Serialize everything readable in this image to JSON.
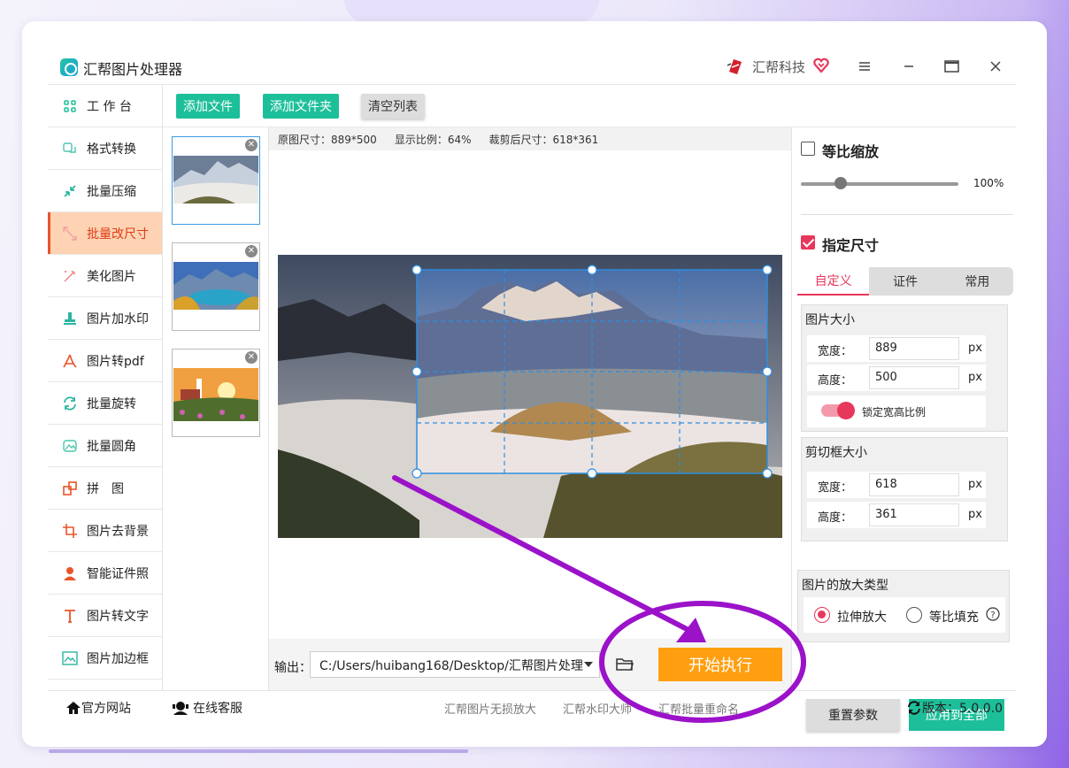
{
  "window": {
    "title": "汇帮图片处理器",
    "brand": "汇帮科技"
  },
  "sidebar": {
    "items": [
      {
        "label": "工 作 台",
        "icon": "grid-icon"
      },
      {
        "label": "格式转换",
        "icon": "convert-icon"
      },
      {
        "label": "批量压缩",
        "icon": "compress-icon"
      },
      {
        "label": "批量改尺寸",
        "icon": "resize-icon",
        "active": true
      },
      {
        "label": "美化图片",
        "icon": "beautify-icon"
      },
      {
        "label": "图片加水印",
        "icon": "watermark-icon"
      },
      {
        "label": "图片转pdf",
        "icon": "pdf-icon"
      },
      {
        "label": "批量旋转",
        "icon": "rotate-icon"
      },
      {
        "label": "批量圆角",
        "icon": "round-corner-icon"
      },
      {
        "label": "拼　图",
        "icon": "puzzle-icon"
      },
      {
        "label": "图片去背景",
        "icon": "crop-icon"
      },
      {
        "label": "智能证件照",
        "icon": "person-icon"
      },
      {
        "label": "图片转文字",
        "icon": "text-icon"
      },
      {
        "label": "图片加边框",
        "icon": "frame-icon"
      }
    ]
  },
  "toolbar": {
    "add_file": "添加文件",
    "add_folder": "添加文件夹",
    "clear_list": "清空列表"
  },
  "preview": {
    "original_size": "原图尺寸：889*500",
    "display_ratio": "显示比例：64%",
    "cropped_size": "裁剪后尺寸：618*361"
  },
  "output": {
    "label": "输出：",
    "path": "C:/Users/huibang168/Desktop/汇帮图片处理",
    "start_label": "开始执行"
  },
  "right": {
    "proportional_label": "等比缩放",
    "proportional_checked": false,
    "scale_percent": "100%",
    "specify_size_label": "指定尺寸",
    "specify_checked": true,
    "tabs": [
      "自定义",
      "证件",
      "常用"
    ],
    "image_size_title": "图片大小",
    "width_label": "宽度：",
    "height_label": "高度：",
    "image_width": "889",
    "image_height": "500",
    "unit": "px",
    "lock_ratio_label": "锁定宽高比例",
    "crop_size_title": "剪切框大小",
    "crop_width": "618",
    "crop_height": "361",
    "enlarge_type_title": "图片的放大类型",
    "stretch_label": "拉伸放大",
    "fill_label": "等比填充",
    "reset_label": "重置参数",
    "apply_all_label": "应用到全部"
  },
  "status": {
    "website": "官方网站",
    "support": "在线客服",
    "links": [
      "汇帮图片无损放大",
      "汇帮水印大师",
      "汇帮批量重命名"
    ],
    "version": "版本：5.0.0.0"
  },
  "colors": {
    "accent": "#e8375c",
    "green": "#1dbf9a",
    "orange": "#ff9f10",
    "annotation": "#9b12c9"
  }
}
